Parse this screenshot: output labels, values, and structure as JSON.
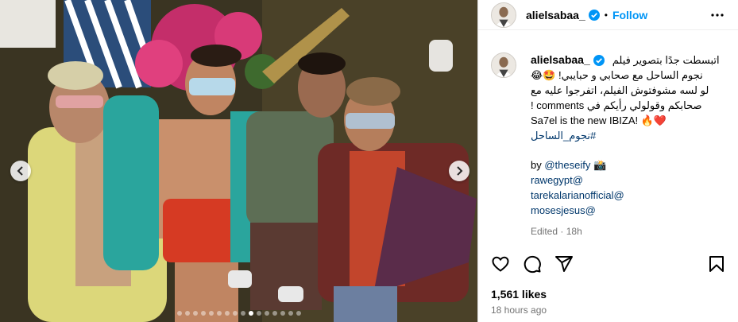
{
  "post": {
    "username": "alielsabaa_",
    "follow_label": "Follow",
    "separator": "•",
    "caption": {
      "lines": [
        "اتبسطت جدًا بتصوير فيلم",
        "نجوم الساحل مع صحابي و حبايبي! 🤩😂",
        "لو لسه مشوفتوش الفيلم، اتفرجوا عليه مع",
        "صحابكم وقولولي رأيكم في comments !",
        "Sa7el is the new IBIZA! 🔥❤️",
        "#نجوم_الساحل"
      ],
      "credit_by": "by ",
      "credit_handle": "@theseify",
      "credit_emoji": "📸",
      "mentions": [
        "rawegypt@",
        "tarekalarianofficial@",
        "mosesjesus@"
      ],
      "edited": "Edited",
      "edited_sep": "·",
      "edited_time": "18h"
    },
    "likes": "1,561 likes",
    "time_ago": "18 hours ago"
  },
  "carousel": {
    "dots": 16,
    "active_index": 9
  },
  "icons": {
    "verified": "verified-badge-icon",
    "more": "more-options-icon",
    "like": "heart-icon",
    "comment": "comment-icon",
    "share": "share-icon",
    "save": "bookmark-icon",
    "prev": "chevron-left-icon",
    "next": "chevron-right-icon"
  },
  "colors": {
    "accent": "#0095f6",
    "link": "#00376b",
    "muted": "#737373"
  }
}
